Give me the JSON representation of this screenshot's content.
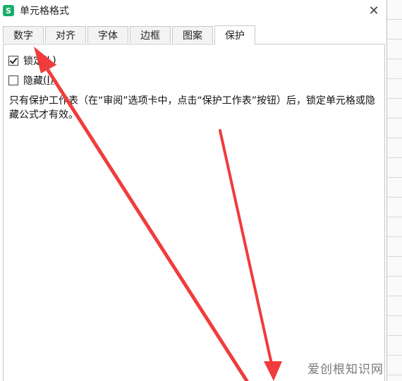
{
  "dialog": {
    "title": "单元格格式",
    "app_icon_letter": "S",
    "close_glyph": "✕"
  },
  "tabs": [
    {
      "label": "数字",
      "active": false
    },
    {
      "label": "对齐",
      "active": false
    },
    {
      "label": "字体",
      "active": false
    },
    {
      "label": "边框",
      "active": false
    },
    {
      "label": "图案",
      "active": false
    },
    {
      "label": "保护",
      "active": true
    }
  ],
  "protection": {
    "lock": {
      "label": "锁定",
      "hotkey": "(L)",
      "checked": true
    },
    "hide": {
      "label": "隐藏",
      "hotkey": "(I)",
      "checked": false
    },
    "description": "只有保护工作表（在“审阅”选项卡中，点击“保护工作表”按钮）后，锁定单元格或隐藏公式才有效。"
  },
  "annotation_color": "#f03c3c",
  "watermark": "爱创根知识网"
}
